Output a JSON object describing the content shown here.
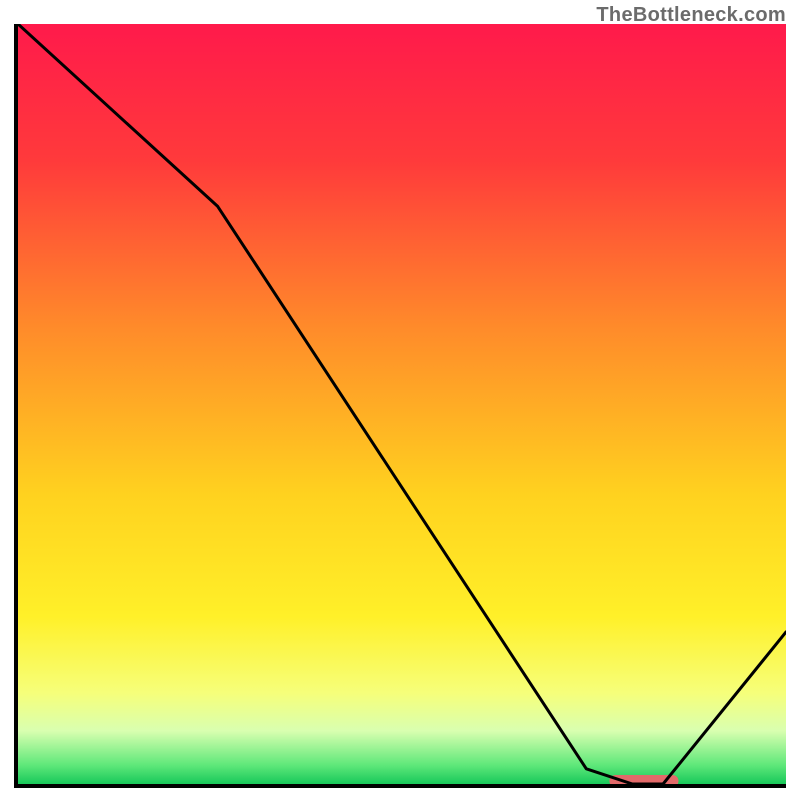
{
  "watermark": "TheBottleneck.com",
  "chart_data": {
    "type": "line",
    "title": "",
    "xlabel": "",
    "ylabel": "",
    "xlim": [
      0,
      100
    ],
    "ylim": [
      0,
      100
    ],
    "series": [
      {
        "name": "curve",
        "x": [
          0,
          26,
          74,
          80,
          84,
          100
        ],
        "values": [
          100,
          76,
          2,
          0,
          0,
          20
        ]
      }
    ],
    "background_gradient_stops": [
      {
        "pos": 0.0,
        "color": "#ff1a4b"
      },
      {
        "pos": 0.18,
        "color": "#ff3a3b"
      },
      {
        "pos": 0.4,
        "color": "#ff8b2a"
      },
      {
        "pos": 0.62,
        "color": "#ffd21f"
      },
      {
        "pos": 0.78,
        "color": "#fff029"
      },
      {
        "pos": 0.88,
        "color": "#f6ff7a"
      },
      {
        "pos": 0.93,
        "color": "#d9ffb0"
      },
      {
        "pos": 0.975,
        "color": "#5fe87a"
      },
      {
        "pos": 1.0,
        "color": "#18c85a"
      }
    ],
    "marker": {
      "x_start": 77,
      "x_end": 86,
      "y": 0,
      "color": "#e36a6a"
    },
    "axes": {
      "left": true,
      "bottom": true,
      "grid": false,
      "ticks": false
    }
  }
}
